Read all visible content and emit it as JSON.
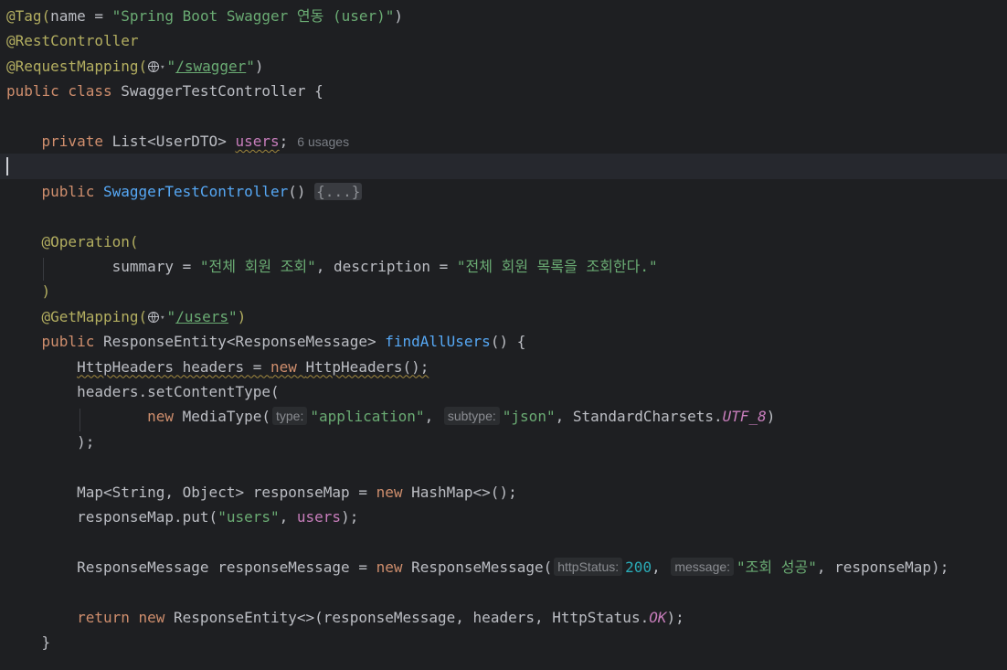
{
  "editor": {
    "lines": [
      {
        "parts": [
          {
            "t": "@Tag(",
            "c": "ann"
          },
          {
            "t": "name = "
          },
          {
            "t": "\"Spring Boot Swagger 연동 (user)\"",
            "c": "str"
          },
          {
            "t": ")"
          }
        ]
      },
      {
        "parts": [
          {
            "t": "@RestController",
            "c": "ann"
          }
        ]
      },
      {
        "parts": [
          {
            "t": "@RequestMapping(",
            "c": "ann"
          },
          {
            "globe": true
          },
          {
            "t": "\"",
            "c": "str"
          },
          {
            "t": "/swagger",
            "c": "str link"
          },
          {
            "t": "\"",
            "c": "str"
          },
          {
            "t": ")"
          }
        ]
      },
      {
        "parts": [
          {
            "t": "public class ",
            "c": "kw"
          },
          {
            "t": "SwaggerTestController {"
          }
        ]
      },
      {
        "parts": []
      },
      {
        "parts": [
          {
            "t": "    "
          },
          {
            "t": "private ",
            "c": "kw"
          },
          {
            "t": "List<UserDTO> "
          },
          {
            "t": "users",
            "c": "field squig"
          },
          {
            "t": ";"
          },
          {
            "usages": "6 usages"
          }
        ]
      },
      {
        "parts": [],
        "current": true
      },
      {
        "parts": [
          {
            "t": "    "
          },
          {
            "t": "public ",
            "c": "kw"
          },
          {
            "t": "SwaggerTestController",
            "c": "fn"
          },
          {
            "t": "() "
          },
          {
            "t": "{...}",
            "c": "fold"
          }
        ]
      },
      {
        "parts": []
      },
      {
        "parts": [
          {
            "t": "    "
          },
          {
            "t": "@Operation(",
            "c": "ann"
          }
        ]
      },
      {
        "parts": [
          {
            "t": "            summary = "
          },
          {
            "t": "\"전체 회원 조회\"",
            "c": "str"
          },
          {
            "t": ", description = "
          },
          {
            "t": "\"전체 회원 목록을 조회한다.\"",
            "c": "str"
          }
        ]
      },
      {
        "parts": [
          {
            "t": "    )",
            "c": "ann"
          }
        ]
      },
      {
        "parts": [
          {
            "t": "    "
          },
          {
            "t": "@GetMapping(",
            "c": "ann"
          },
          {
            "globe": true
          },
          {
            "t": "\"",
            "c": "str"
          },
          {
            "t": "/users",
            "c": "str link"
          },
          {
            "t": "\"",
            "c": "str"
          },
          {
            "t": ")",
            "c": "ann"
          }
        ]
      },
      {
        "parts": [
          {
            "t": "    "
          },
          {
            "t": "public ",
            "c": "kw"
          },
          {
            "t": "ResponseEntity<ResponseMessage> "
          },
          {
            "t": "findAllUsers",
            "c": "fn"
          },
          {
            "t": "() {"
          }
        ]
      },
      {
        "parts": [
          {
            "t": "        "
          },
          {
            "t": "HttpHeaders headers = ",
            "c": "squig"
          },
          {
            "t": "new ",
            "c": "kw squig"
          },
          {
            "t": "HttpHeaders();",
            "c": "squig"
          }
        ]
      },
      {
        "parts": [
          {
            "t": "        headers.setContentType("
          }
        ]
      },
      {
        "parts": [
          {
            "t": "                "
          },
          {
            "t": "new ",
            "c": "kw"
          },
          {
            "t": "MediaType("
          },
          {
            "hint": "type:"
          },
          {
            "t": "\"application\"",
            "c": "str"
          },
          {
            "t": ", "
          },
          {
            "hint": "subtype:"
          },
          {
            "t": "\"json\"",
            "c": "str"
          },
          {
            "t": ", StandardCharsets."
          },
          {
            "t": "UTF_8",
            "c": "const"
          },
          {
            "t": ")"
          }
        ]
      },
      {
        "parts": [
          {
            "t": "        );"
          }
        ]
      },
      {
        "parts": []
      },
      {
        "parts": [
          {
            "t": "        Map<String, Object> responseMap = "
          },
          {
            "t": "new ",
            "c": "kw"
          },
          {
            "t": "HashMap<>();"
          }
        ]
      },
      {
        "parts": [
          {
            "t": "        responseMap.put("
          },
          {
            "t": "\"users\"",
            "c": "str"
          },
          {
            "t": ", "
          },
          {
            "t": "users",
            "c": "field"
          },
          {
            "t": ");"
          }
        ]
      },
      {
        "parts": []
      },
      {
        "parts": [
          {
            "t": "        ResponseMessage responseMessage = "
          },
          {
            "t": "new ",
            "c": "kw"
          },
          {
            "t": "ResponseMessage("
          },
          {
            "hint": "httpStatus:"
          },
          {
            "t": "200",
            "c": "num"
          },
          {
            "t": ", "
          },
          {
            "hint": "message:"
          },
          {
            "t": "\"조회 성공\"",
            "c": "str"
          },
          {
            "t": ", responseMap);"
          }
        ]
      },
      {
        "parts": []
      },
      {
        "parts": [
          {
            "t": "        "
          },
          {
            "t": "return new ",
            "c": "kw"
          },
          {
            "t": "ResponseEntity<>(responseMessage, headers, HttpStatus."
          },
          {
            "t": "OK",
            "c": "const"
          },
          {
            "t": ");"
          }
        ]
      },
      {
        "parts": [
          {
            "t": "    }"
          }
        ]
      }
    ]
  }
}
